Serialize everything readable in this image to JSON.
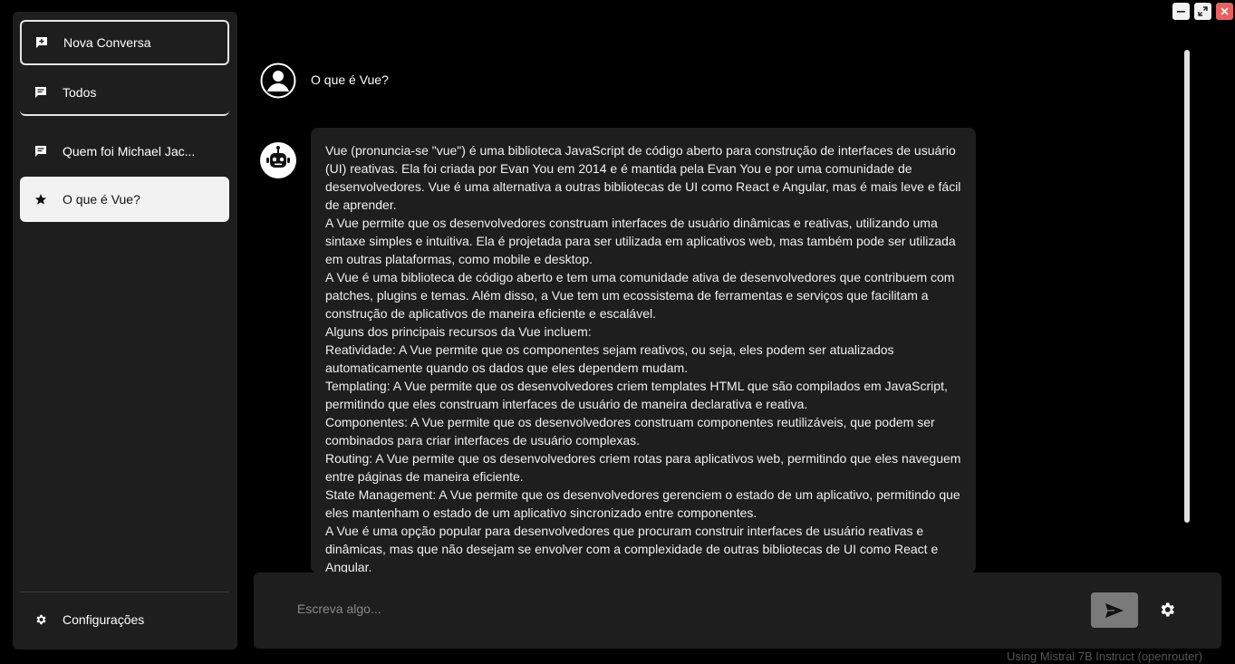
{
  "window_controls": {
    "minimize": "minimize-icon",
    "maximize": "maximize-icon",
    "close": "close-icon"
  },
  "sidebar": {
    "new_chat_label": "Nova Conversa",
    "all_label": "Todos",
    "conversations": [
      {
        "label": "Quem foi Michael Jac...",
        "icon": "chat-icon"
      },
      {
        "label": "O que é Vue?",
        "icon": "star-icon"
      }
    ],
    "settings_label": "Configurações"
  },
  "chat": {
    "user_message": "O que é Vue?",
    "assistant_paragraphs": [
      "Vue (pronuncia-se \"vue\") é uma biblioteca JavaScript de código aberto para construção de interfaces de usuário (UI) reativas. Ela foi criada por Evan You em 2014 e é mantida pela Evan You e por uma comunidade de desenvolvedores. Vue é uma alternativa a outras bibliotecas de UI como React e Angular, mas é mais leve e fácil de aprender.",
      "A Vue permite que os desenvolvedores construam interfaces de usuário dinâmicas e reativas, utilizando uma sintaxe simples e intuitiva. Ela é projetada para ser utilizada em aplicativos web, mas também pode ser utilizada em outras plataformas, como mobile e desktop.",
      "A Vue é uma biblioteca de código aberto e tem uma comunidade ativa de desenvolvedores que contribuem com patches, plugins e temas. Além disso, a Vue tem um ecossistema de ferramentas e serviços que facilitam a construção de aplicativos de maneira eficiente e escalável.",
      "Alguns dos principais recursos da Vue incluem:",
      "Reatividade: A Vue permite que os componentes sejam reativos, ou seja, eles podem ser atualizados automaticamente quando os dados que eles dependem mudam.",
      "Templating: A Vue permite que os desenvolvedores criem templates HTML que são compilados em JavaScript, permitindo que eles construam interfaces de usuário de maneira declarativa e reativa.",
      "Componentes: A Vue permite que os desenvolvedores construam componentes reutilizáveis, que podem ser combinados para criar interfaces de usuário complexas.",
      "Routing: A Vue permite que os desenvolvedores criem rotas para aplicativos web, permitindo que eles naveguem entre páginas de maneira eficiente.",
      "State Management: A Vue permite que os desenvolvedores gerenciem o estado de um aplicativo, permitindo que eles mantenham o estado de um aplicativo sincronizado entre componentes.",
      "A Vue é uma opção popular para desenvolvedores que procuram construir interfaces de usuário reativas e dinâmicas, mas que não desejam se envolver com a complexidade de outras bibliotecas de UI como React e Angular."
    ]
  },
  "input": {
    "placeholder": "Escreva algo...",
    "value": ""
  },
  "footer": {
    "model_info": "Using Mistral 7B Instruct (openrouter)"
  },
  "colors": {
    "background": "#000000",
    "panel": "#1e1e1e",
    "active_item": "#f2f2f2",
    "close_button": "#ec5f5f",
    "send_button": "#7a7a7a"
  }
}
